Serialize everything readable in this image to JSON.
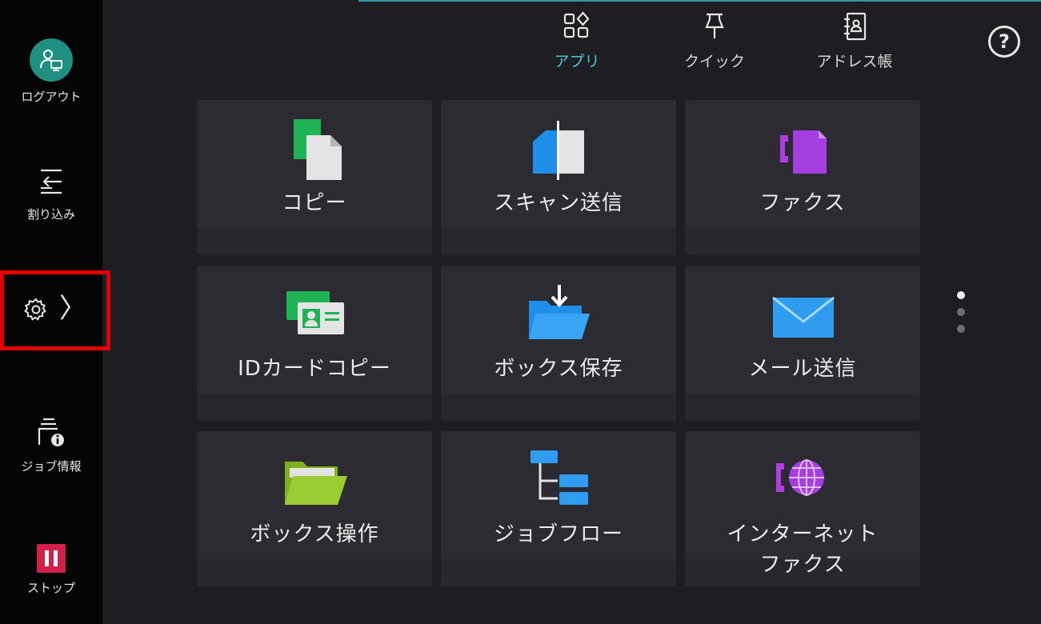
{
  "sidebar": {
    "logout": {
      "label": "ログアウト",
      "icon": "user-monitor-icon"
    },
    "interrupt": {
      "label": "割り込み",
      "icon": "interrupt-icon"
    },
    "settings": {
      "icon": "gear-icon",
      "chevron": "〉"
    },
    "job_info": {
      "label": "ジョブ情報",
      "icon": "job-info-icon"
    },
    "stop": {
      "label": "ストップ",
      "icon": "pause-icon"
    }
  },
  "top_tabs": [
    {
      "label": "アプリ",
      "icon": "apps-grid-icon",
      "active": true
    },
    {
      "label": "クイック",
      "icon": "pushpin-icon",
      "active": false
    },
    {
      "label": "アドレス帳",
      "icon": "address-book-icon",
      "active": false
    }
  ],
  "help": {
    "label": "?",
    "icon": "help-icon"
  },
  "tiles": [
    {
      "label": "コピー",
      "icon": "copy-icon"
    },
    {
      "label": "スキャン送信",
      "icon": "scan-send-icon"
    },
    {
      "label": "ファクス",
      "icon": "fax-icon"
    },
    {
      "label": "IDカードコピー",
      "icon": "id-card-copy-icon"
    },
    {
      "label": "ボックス保存",
      "icon": "box-save-icon"
    },
    {
      "label": "メール送信",
      "icon": "mail-send-icon"
    },
    {
      "label": "ボックス操作",
      "icon": "box-operation-icon"
    },
    {
      "label": "ジョブフロー",
      "icon": "job-flow-icon"
    },
    {
      "label": "インターネット",
      "label_line2": "ファクス",
      "icon": "internet-fax-icon"
    }
  ],
  "pagination": {
    "current": 1,
    "total": 3
  },
  "colors": {
    "accent": "#4ac4dc",
    "highlight_border": "#e30000",
    "stop": "#d2204a",
    "avatar": "#1f8f82"
  }
}
